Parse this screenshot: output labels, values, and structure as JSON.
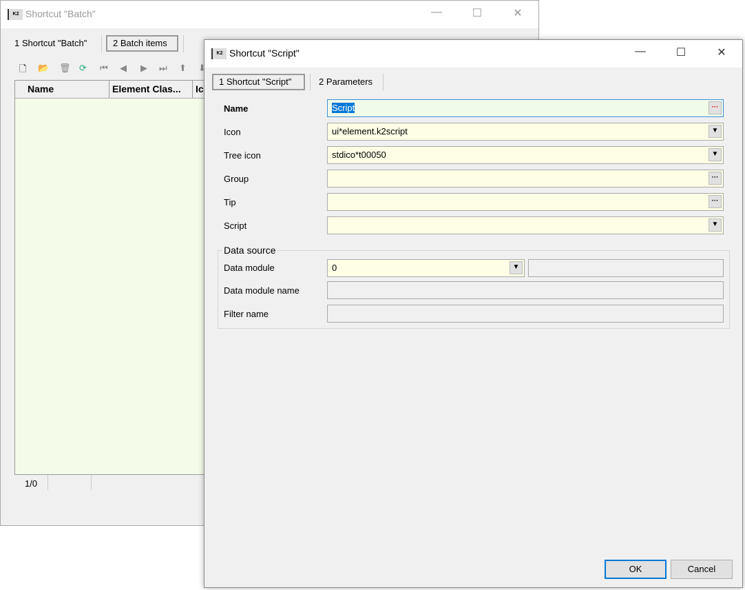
{
  "back_window": {
    "title": "Shortcut \"Batch\"",
    "tabs": [
      "1 Shortcut \"Batch\"",
      "2 Batch items"
    ],
    "columns": [
      "Name",
      "Element Clas...",
      "Ic"
    ],
    "status": "1/0",
    "grid_bg": "#f4fce9"
  },
  "front_window": {
    "title": "Shortcut \"Script\"",
    "tabs": [
      "1 Shortcut \"Script\"",
      "2 Parameters"
    ],
    "fields": [
      {
        "label": "Name",
        "value": "Script"
      },
      {
        "label": "Icon",
        "value": "ui*element.k2script"
      },
      {
        "label": "Tree icon",
        "value": "stdico*t00050"
      },
      {
        "label": "Group",
        "value": ""
      },
      {
        "label": "Tip",
        "value": ""
      },
      {
        "label": "Script",
        "value": ""
      }
    ],
    "data_source": {
      "title": "Data source",
      "data_module_label": "Data module",
      "data_module_value": "0",
      "data_module_name_label": "Data module name",
      "filter_name_label": "Filter name"
    },
    "ok": "OK",
    "cancel": "Cancel"
  },
  "colors": {
    "input_bg": "#fefee6",
    "selection": "#0078d7",
    "focused_border": "#3c8fd8"
  }
}
